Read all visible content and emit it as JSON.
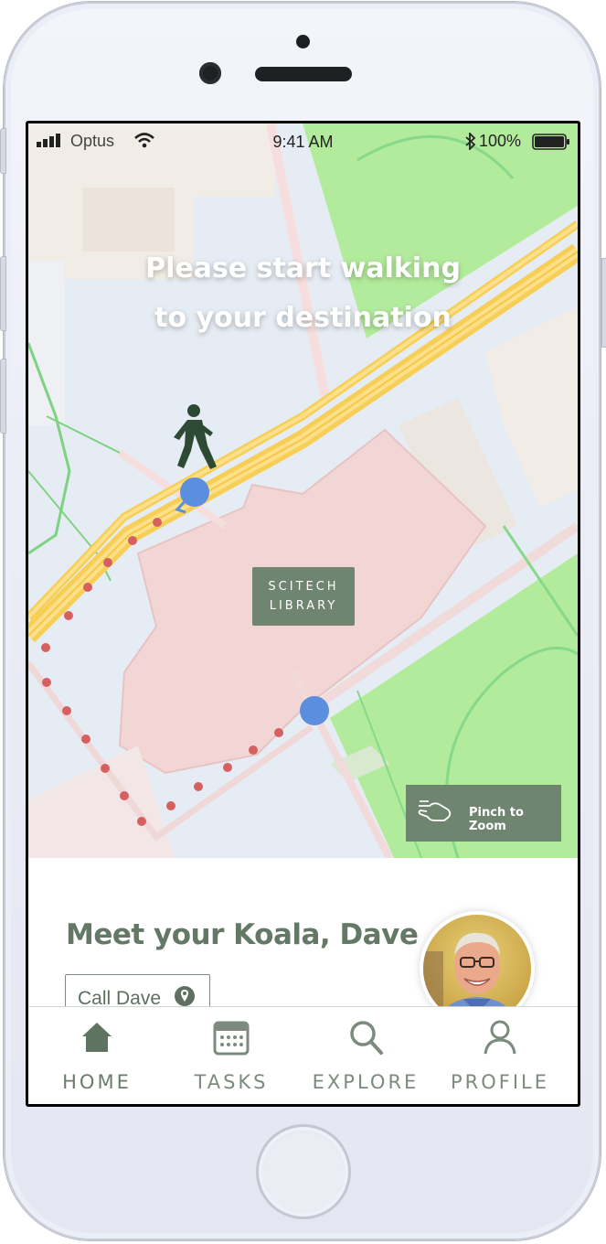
{
  "status_bar": {
    "carrier": "Optus",
    "time": "9:41 AM",
    "battery": "100%"
  },
  "map": {
    "instruction_line1": "Please start walking",
    "instruction_line2": "to your destination",
    "library_line1": "SCITECH",
    "library_line2": "LIBRARY",
    "pinch_label": "Pinch to Zoom"
  },
  "koala_card": {
    "title": "Meet your Koala, Dave",
    "call_label": "Call Dave"
  },
  "tabs": [
    {
      "label": "HOME",
      "icon": "home-icon"
    },
    {
      "label": "TASKS",
      "icon": "calendar-icon"
    },
    {
      "label": "EXPLORE",
      "icon": "search-icon"
    },
    {
      "label": "PROFILE",
      "icon": "person-icon"
    }
  ],
  "colors": {
    "accent": "#6f8570",
    "route_dots": "#d66060",
    "marker": "#5b8fde",
    "park": "#b3eb9c"
  }
}
